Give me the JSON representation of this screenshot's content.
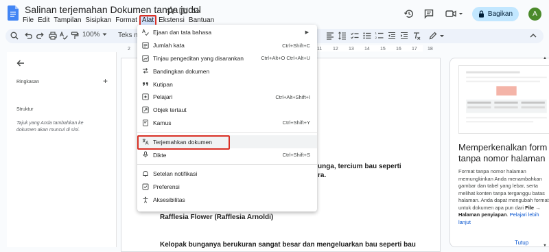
{
  "header": {
    "doc_title": "Salinan terjemahan Dokumen tanpa judul",
    "share_label": "Bagikan",
    "avatar_letter": "A"
  },
  "menubar": [
    {
      "label": "File"
    },
    {
      "label": "Edit"
    },
    {
      "label": "Tampilan"
    },
    {
      "label": "Sisipkan"
    },
    {
      "label": "Format"
    },
    {
      "label": "Alat"
    },
    {
      "label": "Ekstensi"
    },
    {
      "label": "Bantuan"
    }
  ],
  "toolbar": {
    "zoom": "100%",
    "style": "Teks normal"
  },
  "ruler": {
    "marks": [
      "2",
      "1",
      "1",
      "2",
      "3",
      "4",
      "5",
      "6",
      "7",
      "8",
      "9",
      "10",
      "11",
      "12",
      "13",
      "14",
      "15",
      "16",
      "17",
      "18"
    ]
  },
  "outline": {
    "summary_label": "Ringkasan",
    "add_symbol": "+",
    "structure_label": "Struktur",
    "hint": "Tajuk yang Anda tambahkan ke dokumen akan muncul di sini."
  },
  "document": {
    "line1": "unga, tercium bau seperti",
    "line2": "ra.",
    "heading": "Rafflesia Flower (Rafflesia Arnoldi)",
    "line3": "Kelopak bunganya berukuran sangat besar dan mengeluarkan bau seperti bau"
  },
  "tools_menu": {
    "items": [
      {
        "label": "Ejaan dan tata bahasa",
        "shortcut": "",
        "submenu": true,
        "icon": "spellcheck-icon"
      },
      {
        "label": "Jumlah kata",
        "shortcut": "Ctrl+Shift+C",
        "icon": "word-count-icon"
      },
      {
        "label": "Tinjau pengeditan yang disarankan",
        "shortcut": "Ctrl+Alt+O Ctrl+Alt+U",
        "icon": "review-icon"
      },
      {
        "label": "Bandingkan dokumen",
        "shortcut": "",
        "icon": "compare-icon"
      },
      {
        "label": "Kutipan",
        "shortcut": "",
        "icon": "quote-icon"
      },
      {
        "label": "Pelajari",
        "shortcut": "Ctrl+Alt+Shift+I",
        "icon": "explore-icon"
      },
      {
        "label": "Objek tertaut",
        "shortcut": "",
        "icon": "linked-objects-icon"
      },
      {
        "label": "Kamus",
        "shortcut": "Ctrl+Shift+Y",
        "icon": "dictionary-icon"
      },
      {
        "label": "Terjemahkan dokumen",
        "shortcut": "",
        "icon": "translate-icon"
      },
      {
        "label": "Dikte",
        "shortcut": "Ctrl+Shift+S",
        "icon": "microphone-icon"
      },
      {
        "label": "Setelan notifikasi",
        "shortcut": "",
        "icon": "bell-icon"
      },
      {
        "label": "Preferensi",
        "shortcut": "",
        "icon": "preferences-icon"
      },
      {
        "label": "Aksesibilitas",
        "shortcut": "",
        "icon": "accessibility-icon"
      }
    ]
  },
  "side_card": {
    "title": "Memperkenalkan form\ntanpa nomor halaman",
    "body_1": "Format tanpa nomor halaman\nmemungkinkan Anda menambahkan\ngambar dan tabel yang lebar, serta\nmelihat konten tanpa terganggu batas\nhalaman. Anda dapat mengubah format\nuntuk dokumen apa pun dari ",
    "body_bold_1": "File",
    "body_2": " →",
    "body_bold_2": "Halaman penyiapan",
    "body_3": ". ",
    "body_link": "Pelajari lebih\nlanjut",
    "close_label": "Tutup"
  },
  "colors": {
    "accent": "#0b57d0",
    "highlight_border": "#d93025",
    "share_bg": "#c2e7ff",
    "avatar_bg": "#4b8a2a",
    "docs_blue": "#4285f4"
  }
}
